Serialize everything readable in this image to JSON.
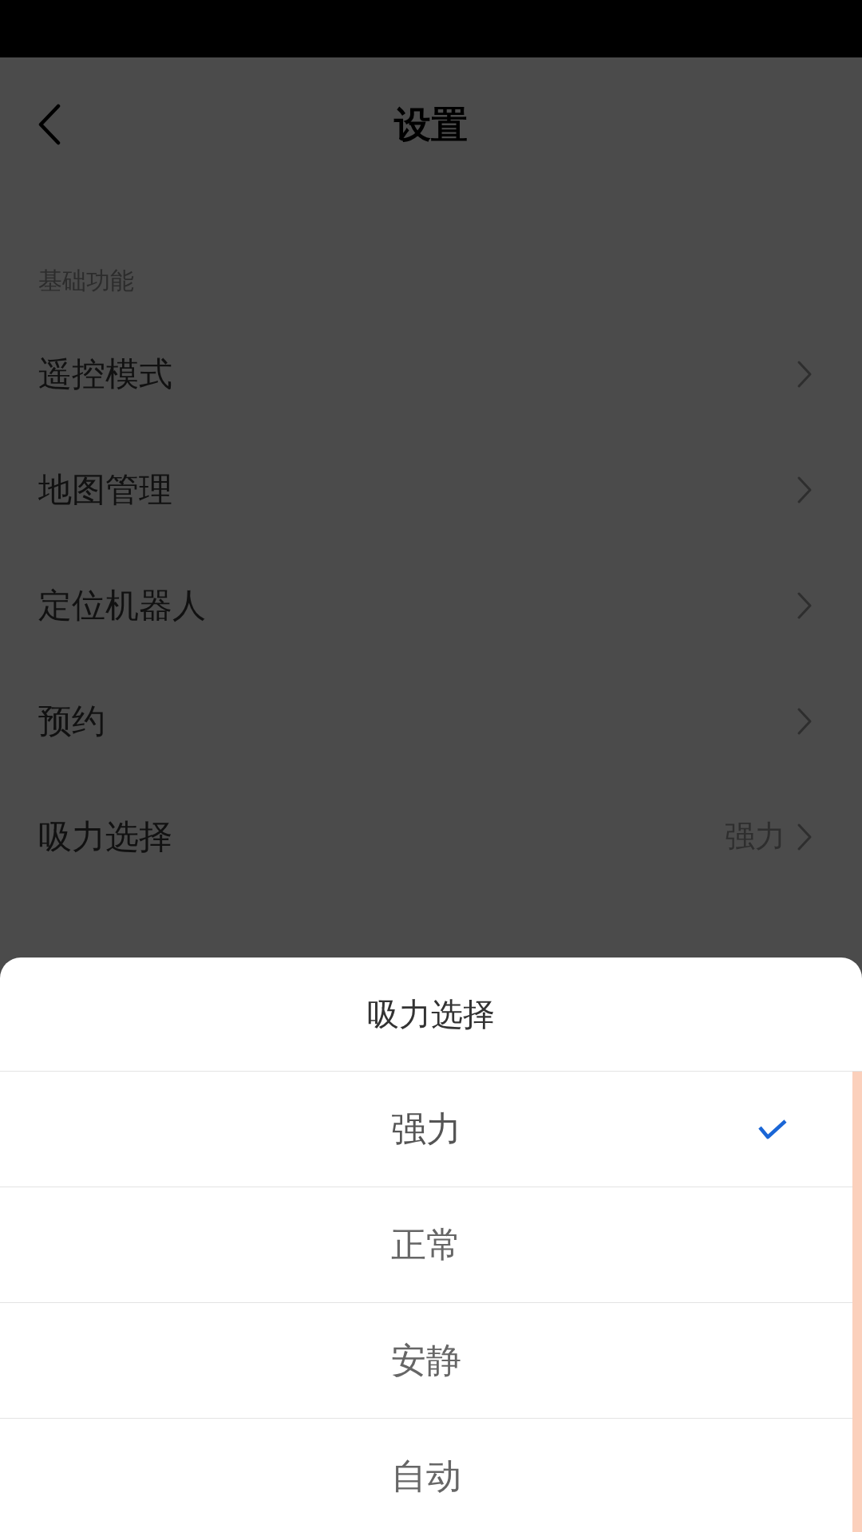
{
  "header": {
    "title": "设置"
  },
  "section": {
    "label": "基础功能"
  },
  "settings": [
    {
      "label": "遥控模式"
    },
    {
      "label": "地图管理"
    },
    {
      "label": "定位机器人"
    },
    {
      "label": "预约"
    },
    {
      "label": "吸力选择",
      "value": "强力"
    }
  ],
  "sheet": {
    "title": "吸力选择",
    "options": [
      {
        "label": "强力",
        "selected": true
      },
      {
        "label": "正常",
        "selected": false
      },
      {
        "label": "安静",
        "selected": false
      },
      {
        "label": "自动",
        "selected": false
      }
    ]
  }
}
